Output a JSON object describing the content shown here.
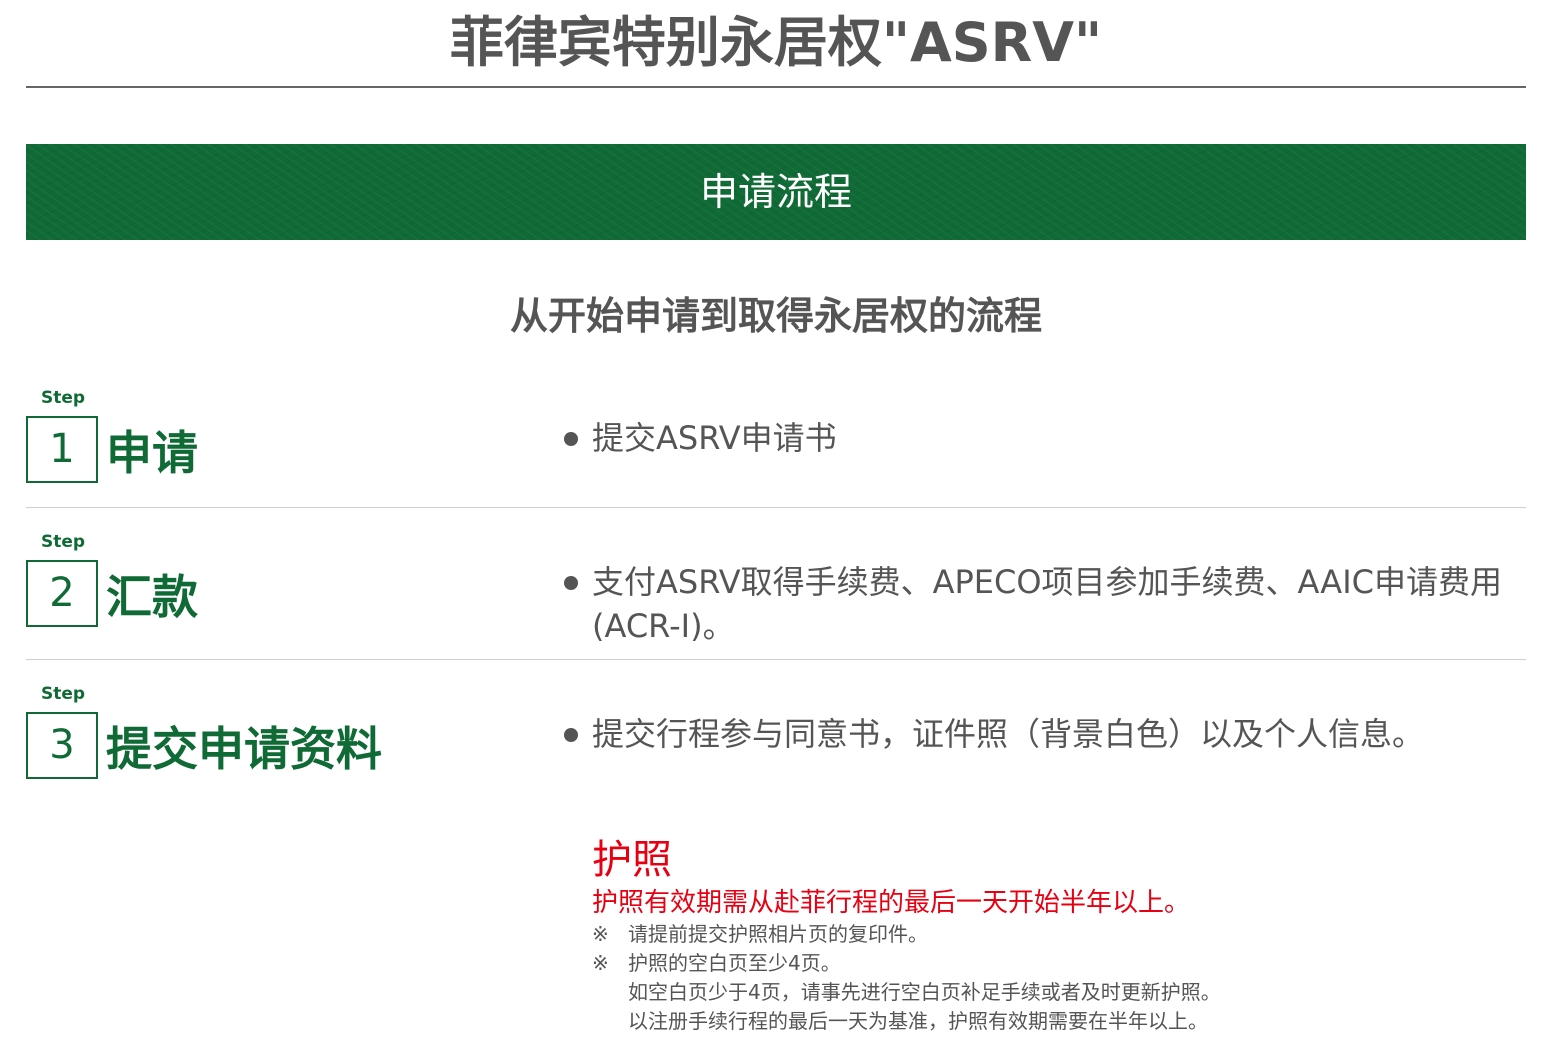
{
  "page": {
    "title": "菲律宾特别永居权\"ASRV\""
  },
  "banner": {
    "title": "申请流程"
  },
  "section": {
    "subtitle": "从开始申请到取得永居权的流程"
  },
  "steps": [
    {
      "label": "Step",
      "number": "1",
      "heading": "申请",
      "bullet": "提交ASRV申请书"
    },
    {
      "label": "Step",
      "number": "2",
      "heading": "汇款",
      "bullet": "支付ASRV取得手续费、APECO项目参加手续费、AAIC申请费用(ACR-I)。"
    },
    {
      "label": "Step",
      "number": "3",
      "heading": "提交申请资料",
      "bullet": "提交行程参与同意书，证件照（背景白色）以及个人信息。"
    }
  ],
  "passport": {
    "heading": "护照",
    "lead": "护照有效期需从赴菲行程的最后一天开始半年以上。",
    "notes": [
      {
        "mark": "※",
        "text": "请提前提交护照相片页的复印件。"
      },
      {
        "mark": "※",
        "text": "护照的空白页至少4页。"
      }
    ],
    "continuation": [
      "如空白页少于4页，请事先进行空白页补足手续或者及时更新护照。",
      "以注册手续行程的最后一天为基准，护照有效期需要在半年以上。"
    ]
  },
  "colors": {
    "brand_green": "#0f6a35",
    "alert_red": "#e60012",
    "text_gray": "#555555"
  }
}
